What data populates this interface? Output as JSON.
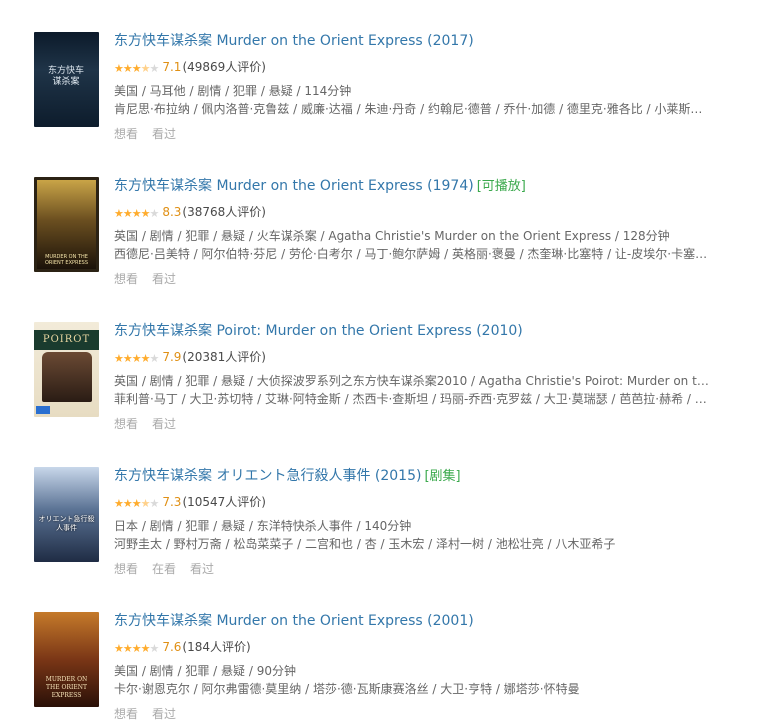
{
  "actions": {
    "want": "想看",
    "watching": "在看",
    "watched": "看过"
  },
  "results": [
    {
      "title": "东方快车谋杀案 Murder on the Orient Express (2017)",
      "badge": "",
      "score": "7.1",
      "count": "(49869人评价)",
      "stars": "3.5",
      "meta": "美国 / 马耳他 / 剧情 / 犯罪 / 悬疑 / 114分钟",
      "cast": "肯尼思·布拉纳 / 佩内洛普·克鲁兹 / 威廉·达福 / 朱迪·丹奇 / 约翰尼·德普 / 乔什·加德 / 德里克·雅各比 / 小莱斯利·奥...",
      "poster_text": "东方快车谋杀案",
      "has_watching": false
    },
    {
      "title": "东方快车谋杀案 Murder on the Orient Express (1974)",
      "badge": "[可播放]",
      "score": "8.3",
      "count": "(38768人评价)",
      "stars": "4",
      "meta": "英国 / 剧情 / 犯罪 / 悬疑 / 火车谋杀案 / Agatha Christie's Murder on the Orient Express / 128分钟",
      "cast": "西德尼·吕美特 / 阿尔伯特·芬尼 / 劳伦·白考尔 / 马丁·鲍尔萨姆 / 英格丽·褒曼 / 杰奎琳·比塞特 / 让-皮埃尔·卡塞尔 / ...",
      "poster_text": "MURDER ON THE ORIENT EXPRESS",
      "has_watching": false
    },
    {
      "title": "东方快车谋杀案 Poirot: Murder on the Orient Express (2010)",
      "badge": "",
      "score": "7.9",
      "count": "(20381人评价)",
      "stars": "4",
      "meta": "英国 / 剧情 / 犯罪 / 悬疑 / 大侦探波罗系列之东方快车谋杀案2010 / Agatha Christie's Poirot: Murder on the Orie...",
      "cast": "菲利普·马丁 / 大卫·苏切特 / 艾琳·阿特金斯 / 杰西卡·查斯坦 / 玛丽-乔西·克罗兹 / 大卫·莫瑞瑟 / 芭芭拉·赫希 / 苏珊...",
      "poster_text": "POIROT",
      "has_watching": false
    },
    {
      "title": "东方快车谋杀案 オリエント急行殺人事件 (2015)",
      "badge": "[剧集]",
      "score": "7.3",
      "count": "(10547人评价)",
      "stars": "3.5",
      "meta": "日本 / 剧情 / 犯罪 / 悬疑 / 东洋特快杀人事件 / 140分钟",
      "cast": "河野圭太 / 野村万斋 / 松岛菜菜子 / 二宫和也 / 杏 / 玉木宏 / 泽村一树 / 池松壮亮 / 八木亚希子",
      "poster_text": "オリエント急行殺人事件",
      "has_watching": true
    },
    {
      "title": "东方快车谋杀案 Murder on the Orient Express (2001)",
      "badge": "",
      "score": "7.6",
      "count": "(184人评价)",
      "stars": "4",
      "meta": "美国 / 剧情 / 犯罪 / 悬疑 / 90分钟",
      "cast": "卡尔·谢恩克尔 / 阿尔弗雷德·莫里纳 / 塔莎·德·瓦斯康赛洛丝 / 大卫·亨特 / 娜塔莎·怀特曼",
      "poster_text": "MURDER ON THE ORIENT EXPRESS",
      "has_watching": false
    }
  ]
}
